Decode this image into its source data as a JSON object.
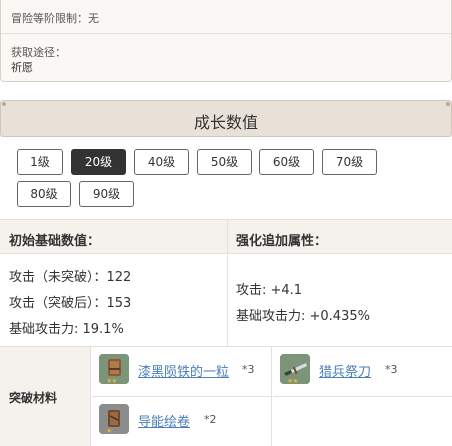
{
  "info": {
    "rank_limit": "冒险等阶限制：无",
    "source_label": "获取途径：",
    "source_value": "祈愿"
  },
  "growth": {
    "title": "成长数值",
    "levels": [
      "1级",
      "20级",
      "40级",
      "50级",
      "60级",
      "70级",
      "80级",
      "90级"
    ],
    "selected_level": "20级"
  },
  "attributes": {
    "base_header": "初始基础数值：",
    "bonus_header": "强化追加属性：",
    "base_lines": [
      "攻击（未突破）：122",
      "攻击（突破后）：153",
      "基础攻击力: 19.1%"
    ],
    "bonus_lines": [
      "攻击: +4.1",
      "基础攻击力: +0.435%"
    ]
  },
  "materials": {
    "label": "突破材料",
    "items": [
      {
        "name": "漆黑陨铁的一粒",
        "count": "*3",
        "icon": "scroll-material-icon",
        "stars": "★★"
      },
      {
        "name": "猎兵祭刀",
        "count": "*3",
        "icon": "dagger-material-icon",
        "stars": "★★"
      },
      {
        "name": "导能绘卷",
        "count": "*2",
        "icon": "scroll-material-icon",
        "stars": "★"
      }
    ]
  },
  "colors": {
    "selected_level_bg": "#333333",
    "link": "#4a7fb8",
    "header_bg": "#e8e1d8",
    "cell_bg": "#f5f1ec"
  }
}
